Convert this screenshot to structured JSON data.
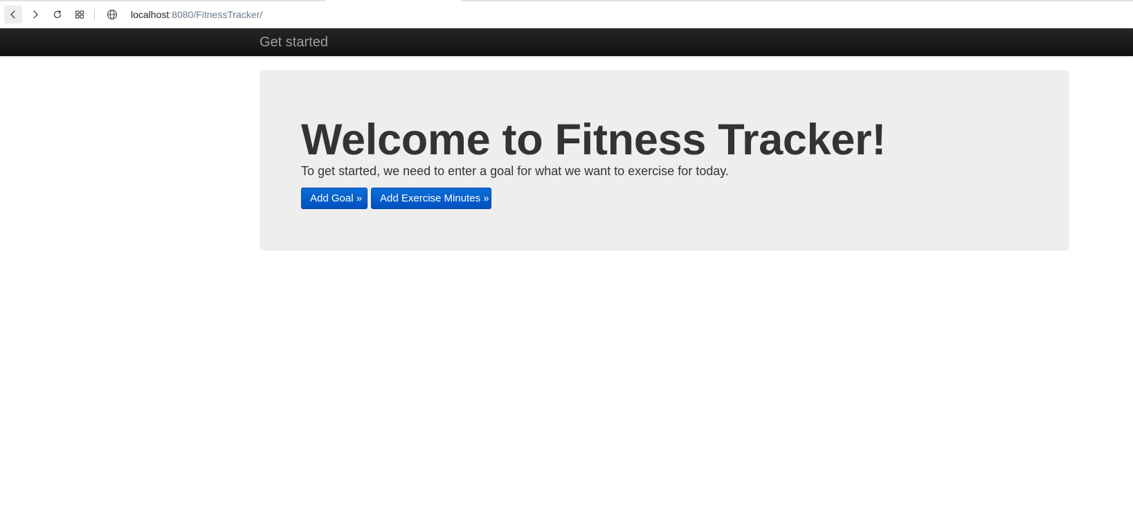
{
  "browser": {
    "address_host": "localhost",
    "address_path": ":8080/FitnessTracker/"
  },
  "navbar": {
    "brand": "Get started"
  },
  "jumbotron": {
    "heading": "Welcome to Fitness Tracker!",
    "lead": "To get started, we need to enter a goal for what we want to exercise for today.",
    "buttons": {
      "add_goal": "Add Goal »",
      "add_minutes": "Add Exercise Minutes »"
    }
  },
  "colors": {
    "navbar_bg": "#1b1b1b",
    "jumbotron_bg": "#eeeeee",
    "primary_button": "#0a62d0",
    "text": "#333333"
  },
  "icons": {
    "back": "back-arrow-icon",
    "forward": "forward-arrow-icon",
    "reload": "reload-icon",
    "apps": "apps-grid-icon",
    "site": "globe-icon"
  }
}
